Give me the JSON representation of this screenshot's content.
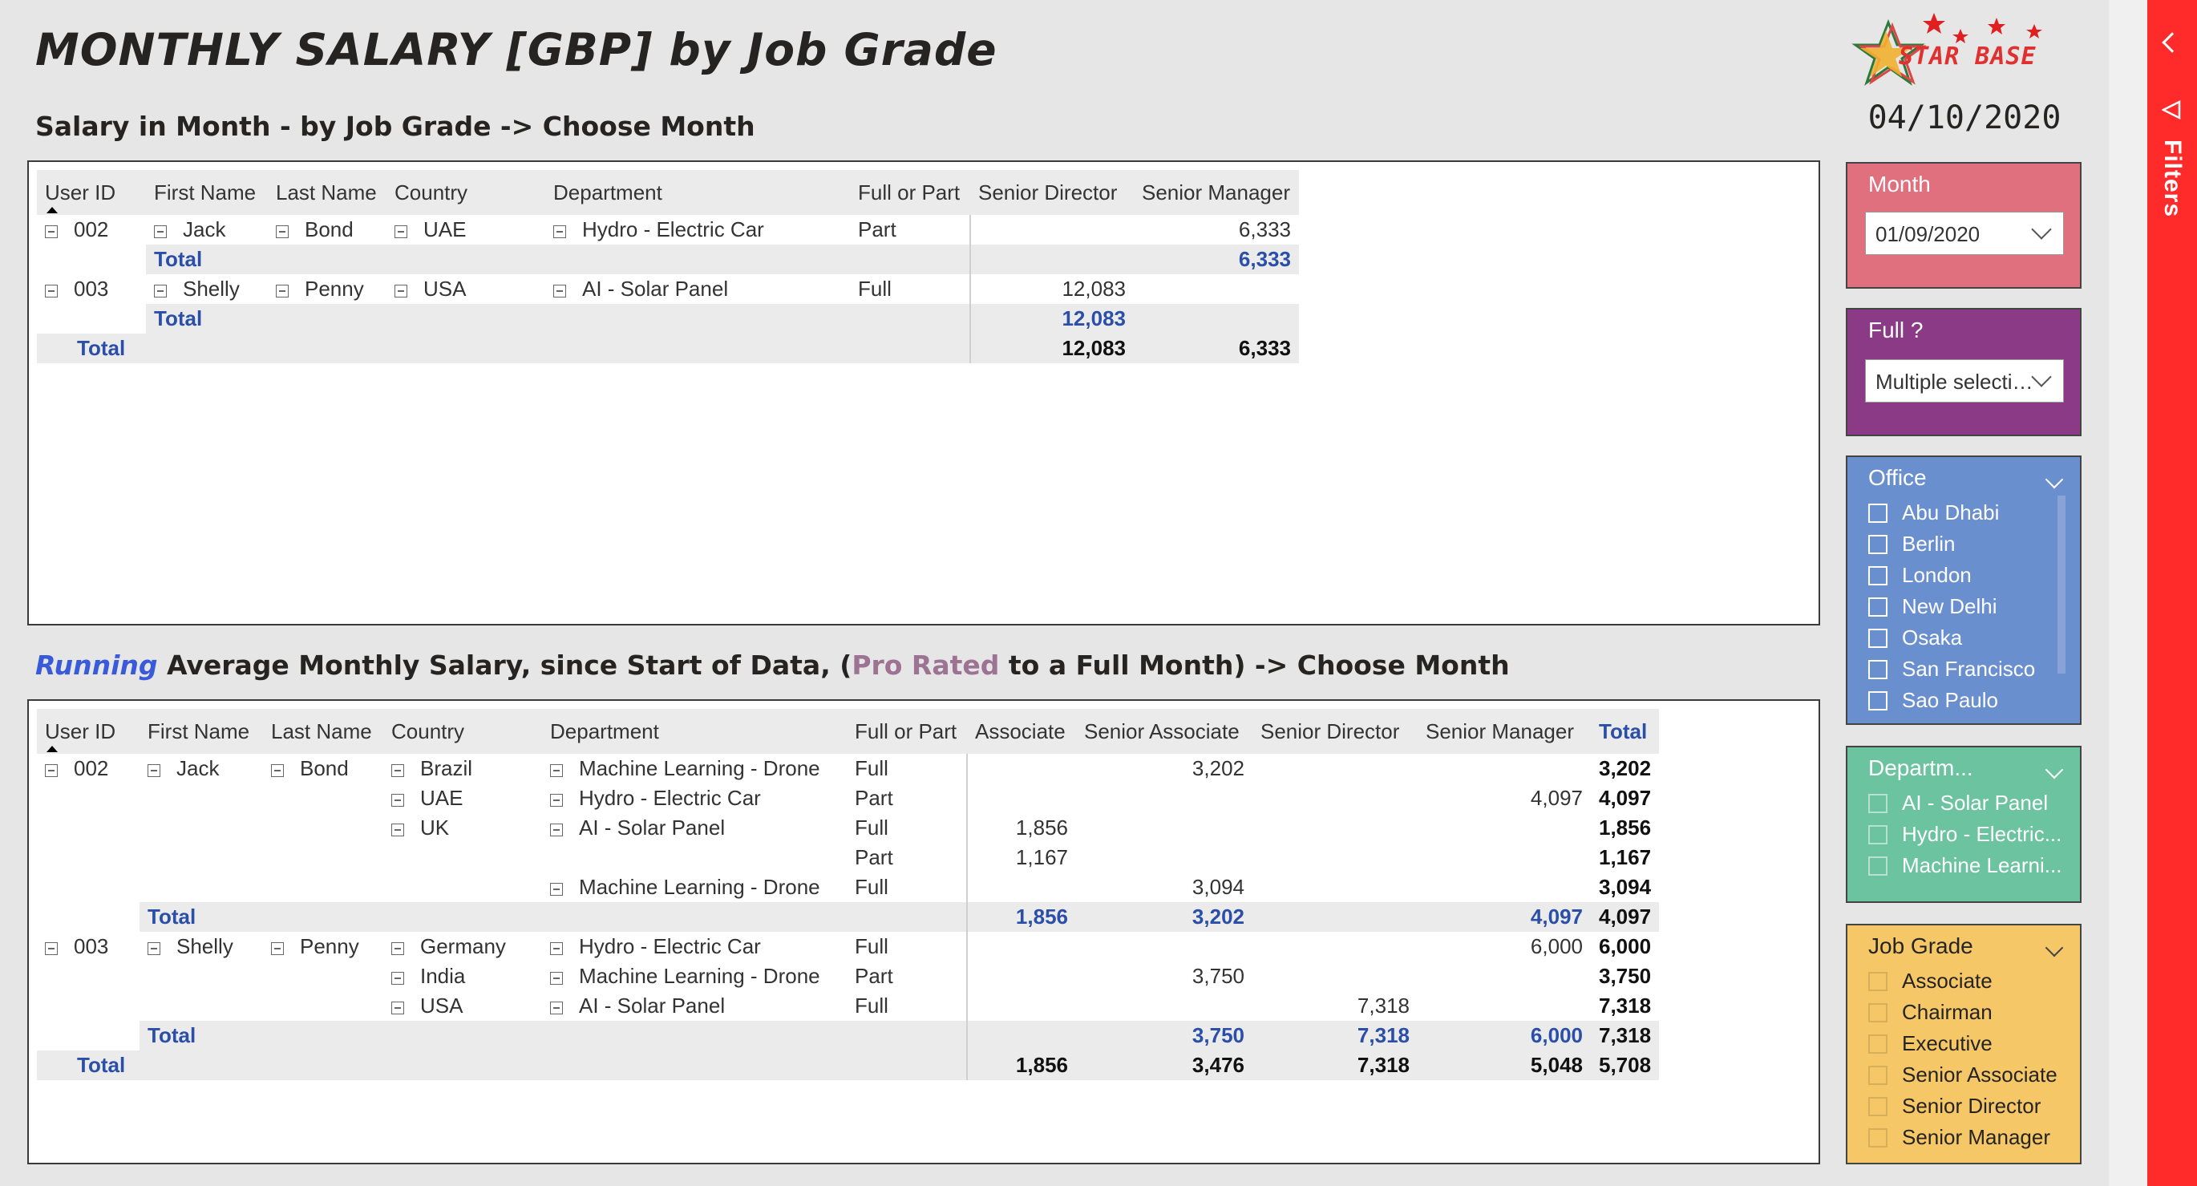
{
  "title": "MONTHLY SALARY [GBP] by Job Grade",
  "date": "04/10/2020",
  "logo": {
    "text": "STAR BASE"
  },
  "section1": {
    "title": "Salary in Month - by Job Grade -> Choose Month",
    "headers": [
      "User ID",
      "First Name",
      "Last Name",
      "Country",
      "Department",
      "Full or Part",
      "Senior Director",
      "Senior Manager"
    ],
    "rows": [
      {
        "type": "data",
        "user_id": "002",
        "first": "Jack",
        "last": "Bond",
        "country": "UAE",
        "dept": "Hydro - Electric Car",
        "fp": "Part",
        "sd": "",
        "sm": "6,333"
      },
      {
        "type": "sub",
        "label": "Total",
        "sd": "",
        "sm": "6,333"
      },
      {
        "type": "data",
        "user_id": "003",
        "first": "Shelly",
        "last": "Penny",
        "country": "USA",
        "dept": "AI - Solar Panel",
        "fp": "Full",
        "sd": "12,083",
        "sm": ""
      },
      {
        "type": "sub",
        "label": "Total",
        "sd": "12,083",
        "sm": ""
      },
      {
        "type": "grand",
        "label": "Total",
        "sd": "12,083",
        "sm": "6,333"
      }
    ]
  },
  "section2": {
    "title_running": "Running",
    "title_part1": " Average Monthly Salary, since Start of Data, (",
    "title_prorated": "Pro Rated",
    "title_part2": " to a Full Month) -> Choose Month",
    "headers": [
      "User ID",
      "First Name",
      "Last Name",
      "Country",
      "Department",
      "Full or Part",
      "Associate",
      "Senior Associate",
      "Senior Director",
      "Senior Manager",
      "Total"
    ],
    "rows": [
      {
        "type": "data",
        "user_id": "002",
        "first": "Jack",
        "last": "Bond",
        "country": "Brazil",
        "dept": "Machine Learning - Drone",
        "fp": "Full",
        "a": "",
        "sa": "3,202",
        "sd": "",
        "sm": "",
        "t": "3,202"
      },
      {
        "type": "data",
        "user_id": "",
        "first": "",
        "last": "",
        "country": "UAE",
        "dept": "Hydro - Electric Car",
        "fp": "Part",
        "a": "",
        "sa": "",
        "sd": "",
        "sm": "4,097",
        "t": "4,097"
      },
      {
        "type": "data",
        "user_id": "",
        "first": "",
        "last": "",
        "country": "UK",
        "dept": "AI - Solar Panel",
        "fp": "Full",
        "a": "1,856",
        "sa": "",
        "sd": "",
        "sm": "",
        "t": "1,856"
      },
      {
        "type": "data",
        "user_id": "",
        "first": "",
        "last": "",
        "country": "",
        "dept": "",
        "fp": "Part",
        "a": "1,167",
        "sa": "",
        "sd": "",
        "sm": "",
        "t": "1,167"
      },
      {
        "type": "data",
        "user_id": "",
        "first": "",
        "last": "",
        "country": "",
        "dept": "Machine Learning - Drone",
        "fp": "Full",
        "a": "",
        "sa": "3,094",
        "sd": "",
        "sm": "",
        "t": "3,094"
      },
      {
        "type": "sub",
        "label": "Total",
        "a": "1,856",
        "sa": "3,202",
        "sd": "",
        "sm": "4,097",
        "t": "4,097"
      },
      {
        "type": "data",
        "user_id": "003",
        "first": "Shelly",
        "last": "Penny",
        "country": "Germany",
        "dept": "Hydro - Electric Car",
        "fp": "Full",
        "a": "",
        "sa": "",
        "sd": "",
        "sm": "6,000",
        "t": "6,000"
      },
      {
        "type": "data",
        "user_id": "",
        "first": "",
        "last": "",
        "country": "India",
        "dept": "Machine Learning - Drone",
        "fp": "Part",
        "a": "",
        "sa": "3,750",
        "sd": "",
        "sm": "",
        "t": "3,750"
      },
      {
        "type": "data",
        "user_id": "",
        "first": "",
        "last": "",
        "country": "USA",
        "dept": "AI - Solar Panel",
        "fp": "Full",
        "a": "",
        "sa": "",
        "sd": "7,318",
        "sm": "",
        "t": "7,318"
      },
      {
        "type": "sub",
        "label": "Total",
        "a": "",
        "sa": "3,750",
        "sd": "7,318",
        "sm": "6,000",
        "t": "7,318"
      },
      {
        "type": "grand",
        "label": "Total",
        "a": "1,856",
        "sa": "3,476",
        "sd": "7,318",
        "sm": "5,048",
        "t": "5,708"
      }
    ]
  },
  "slicers": {
    "month": {
      "title": "Month",
      "value": "01/09/2020",
      "color": "#e0707d"
    },
    "full": {
      "title": "Full ?",
      "value": "Multiple selections",
      "color": "#8b3a86"
    },
    "office": {
      "title": "Office",
      "color": "#6a8fcf",
      "items": [
        "Abu Dhabi",
        "Berlin",
        "London",
        "New Delhi",
        "Osaka",
        "San Francisco",
        "Sao Paulo"
      ]
    },
    "department": {
      "title": "Departm...",
      "color": "#6cc3a0",
      "items": [
        "AI - Solar Panel",
        "Hydro - Electric...",
        "Machine Learni..."
      ]
    },
    "job_grade": {
      "title": "Job Grade",
      "color": "#f5c766",
      "items": [
        "Associate",
        "Chairman",
        "Executive",
        "Senior Associate",
        "Senior Director",
        "Senior Manager"
      ]
    }
  },
  "filters_pane": {
    "label": "Filters",
    "color": "#ff2b2b"
  }
}
